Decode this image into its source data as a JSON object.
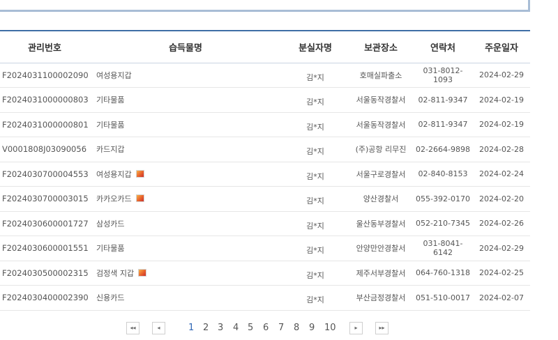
{
  "table": {
    "headers": [
      "관리번호",
      "습득물명",
      "분실자명",
      "보관장소",
      "연락처",
      "주운일자"
    ],
    "rows": [
      {
        "id": "F2024031100002090",
        "item": "여성용지갑",
        "photo": false,
        "name": "김*지",
        "place": "호매실파출소",
        "phone": "031-8012-1093",
        "date": "2024-02-29"
      },
      {
        "id": "F2024031000000803",
        "item": "기타물품",
        "photo": false,
        "name": "김*지",
        "place": "서울동작경찰서",
        "phone": "02-811-9347",
        "date": "2024-02-19"
      },
      {
        "id": "F2024031000000801",
        "item": "기타물품",
        "photo": false,
        "name": "김*지",
        "place": "서울동작경찰서",
        "phone": "02-811-9347",
        "date": "2024-02-19"
      },
      {
        "id": "V0001808J03090056",
        "item": "카드지갑",
        "photo": false,
        "name": "김*지",
        "place": "(주)공항 리무진",
        "phone": "02-2664-9898",
        "date": "2024-02-28"
      },
      {
        "id": "F2024030700004553",
        "item": "여성용지갑",
        "photo": true,
        "name": "김*지",
        "place": "서울구로경찰서",
        "phone": "02-840-8153",
        "date": "2024-02-24"
      },
      {
        "id": "F2024030700003015",
        "item": "카카오카드",
        "photo": true,
        "name": "김*지",
        "place": "양산경찰서",
        "phone": "055-392-0170",
        "date": "2024-02-20"
      },
      {
        "id": "F2024030600001727",
        "item": "삼성카드",
        "photo": false,
        "name": "김*지",
        "place": "울산동부경찰서",
        "phone": "052-210-7345",
        "date": "2024-02-26"
      },
      {
        "id": "F2024030600001551",
        "item": "기타물품",
        "photo": false,
        "name": "김*지",
        "place": "안양만안경찰서",
        "phone": "031-8041-6142",
        "date": "2024-02-29"
      },
      {
        "id": "F2024030500002315",
        "item": "검정색 지갑",
        "photo": true,
        "name": "김*지",
        "place": "제주서부경찰서",
        "phone": "064-760-1318",
        "date": "2024-02-25"
      },
      {
        "id": "F2024030400002390",
        "item": "신용카드",
        "photo": false,
        "name": "김*지",
        "place": "부산금정경찰서",
        "phone": "051-510-0017",
        "date": "2024-02-07"
      }
    ]
  },
  "pager": {
    "first": "◂◂",
    "prev": "◂",
    "next": "▸",
    "last": "▸▸",
    "pages": [
      "1",
      "2",
      "3",
      "4",
      "5",
      "6",
      "7",
      "8",
      "9",
      "10"
    ],
    "current": "1",
    "active_color": "#2f66b5"
  },
  "icons": {
    "photo": "photo-thumbnail-icon"
  }
}
